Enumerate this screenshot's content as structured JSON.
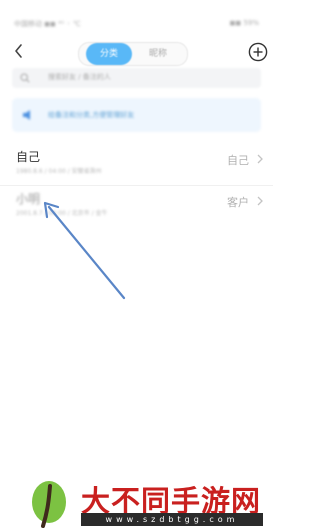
{
  "status_bar": {
    "left": "中国移动 ◼◼ ⁴ᴳ ◦ ℃",
    "right": "◼◼ 59%"
  },
  "tabs": [
    {
      "label": "分类"
    },
    {
      "label": "昵称"
    }
  ],
  "search": {
    "placeholder": "搜索好友 / 备注的人"
  },
  "tip": {
    "text": "给备注和分类,方便管理好友"
  },
  "contacts": [
    {
      "name": "自己",
      "subtitle": "1980.8.6 / 04:00 / 安徽省滁州",
      "tag": "自己"
    },
    {
      "name": "小明",
      "subtitle": "2001.8.7 / 06:00 / 北京市 / 金牛",
      "tag": "客户"
    }
  ],
  "watermark": {
    "title": "大不同手游网",
    "url": "www.szdbtgg.com"
  },
  "colors": {
    "accent": "#59b8f7",
    "tip_bg": "#eef6fe",
    "arrow": "#5a86c7",
    "watermark_red": "#c9201f"
  }
}
